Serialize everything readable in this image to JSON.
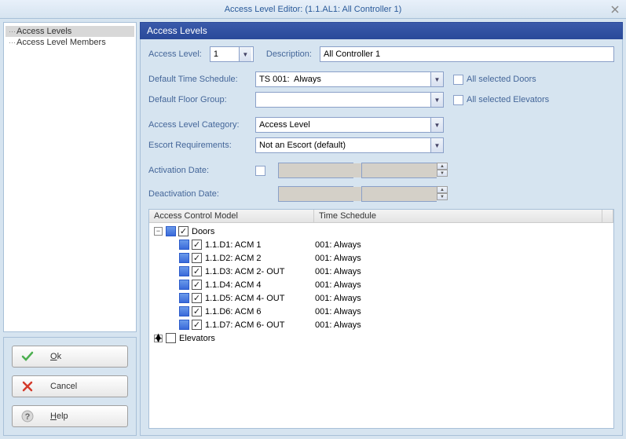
{
  "window": {
    "title": "Access Level Editor: (1.1.AL1: All Controller 1)"
  },
  "nav": {
    "items": [
      {
        "label": "Access Levels",
        "selected": true
      },
      {
        "label": "Access Level Members",
        "selected": false
      }
    ]
  },
  "buttons": {
    "ok": {
      "label": "Ok",
      "underline_index": 0
    },
    "cancel": {
      "label": "Cancel"
    },
    "help": {
      "label": "Help",
      "underline_index": 0
    }
  },
  "panel": {
    "title": "Access Levels"
  },
  "form": {
    "access_level_label": "Access Level:",
    "access_level_value": "1",
    "description_label": "Description:",
    "description_value": "All Controller 1",
    "default_time_schedule_label": "Default Time Schedule:",
    "default_time_schedule_value": "TS 001:  Always",
    "default_floor_group_label": "Default Floor Group:",
    "default_floor_group_value": "",
    "all_selected_doors_label": "All selected Doors",
    "all_selected_doors_checked": false,
    "all_selected_elevators_label": "All selected Elevators",
    "all_selected_elevators_checked": false,
    "category_label": "Access Level Category:",
    "category_value": "Access Level",
    "escort_label": "Escort Requirements:",
    "escort_value": "Not an Escort (default)",
    "activation_label": "Activation Date:",
    "activation_checked": false,
    "activation_date": "",
    "activation_time": "",
    "deactivation_label": "Deactivation Date:",
    "deactivation_date": "",
    "deactivation_time": ""
  },
  "tree": {
    "headers": {
      "model": "Access Control Model",
      "schedule": "Time Schedule"
    },
    "doors_label": "Doors",
    "doors_expanded": true,
    "doors_checked": true,
    "elevators_label": "Elevators",
    "elevators_checked": false,
    "items": [
      {
        "label": "1.1.D1: ACM 1",
        "schedule": "001:  Always",
        "checked": true
      },
      {
        "label": "1.1.D2: ACM 2",
        "schedule": "001:  Always",
        "checked": true
      },
      {
        "label": "1.1.D3: ACM 2- OUT",
        "schedule": "001:  Always",
        "checked": true
      },
      {
        "label": "1.1.D4: ACM 4",
        "schedule": "001:  Always",
        "checked": true
      },
      {
        "label": "1.1.D5: ACM 4- OUT",
        "schedule": "001:  Always",
        "checked": true
      },
      {
        "label": "1.1.D6: ACM 6",
        "schedule": "001:  Always",
        "checked": true
      },
      {
        "label": "1.1.D7: ACM 6- OUT",
        "schedule": "001:  Always",
        "checked": true
      }
    ]
  }
}
